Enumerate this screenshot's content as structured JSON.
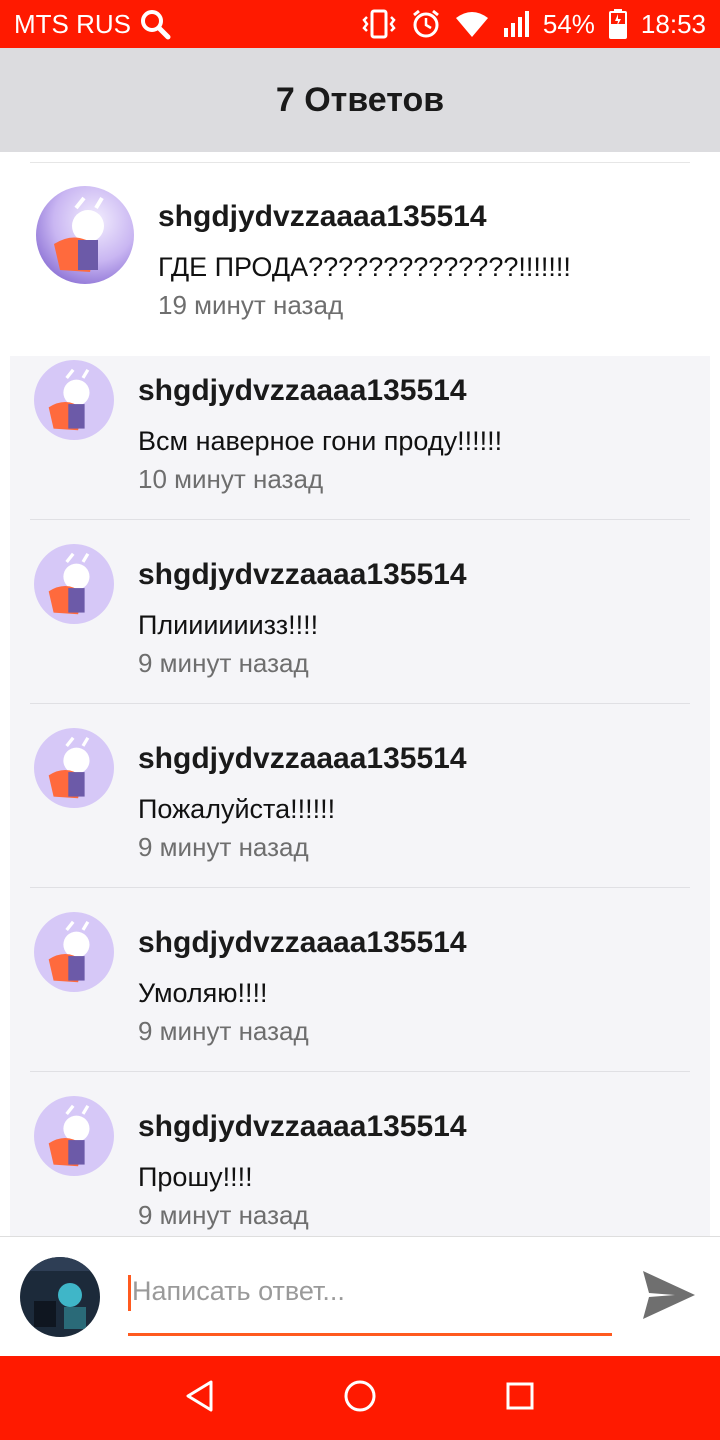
{
  "status_bar": {
    "carrier": "MTS RUS",
    "battery": "54%",
    "time": "18:53"
  },
  "header": {
    "title": "7 Ответов"
  },
  "comment": {
    "author": "shgdjydvzzaaaa135514",
    "text": "ГДЕ ПРОДА??????????????!!!!!!!",
    "time": "19 минут назад"
  },
  "replies": [
    {
      "author": "shgdjydvzzaaaa135514",
      "text": "Всм наверное гони проду!!!!!!",
      "time": "10 минут назад"
    },
    {
      "author": "shgdjydvzzaaaa135514",
      "text": "Плиииииизз!!!!",
      "time": "9 минут назад"
    },
    {
      "author": "shgdjydvzzaaaa135514",
      "text": "Пожалуйста!!!!!!",
      "time": "9 минут назад"
    },
    {
      "author": "shgdjydvzzaaaa135514",
      "text": "Умоляю!!!!",
      "time": "9 минут назад"
    },
    {
      "author": "shgdjydvzzaaaa135514",
      "text": "Прошу!!!!",
      "time": "9 минут назад"
    }
  ],
  "composer": {
    "placeholder": "Написать ответ..."
  },
  "colors": {
    "accent": "#ff1a00",
    "input_accent": "#ff5a1f",
    "header_bg": "#dcdcdf",
    "reply_bg": "#f5f5f8"
  },
  "icons": [
    "search-icon",
    "vibrate-icon",
    "alarm-icon",
    "wifi-icon",
    "signal-icon",
    "battery-icon",
    "send-icon",
    "back-icon",
    "home-icon",
    "recents-icon"
  ]
}
